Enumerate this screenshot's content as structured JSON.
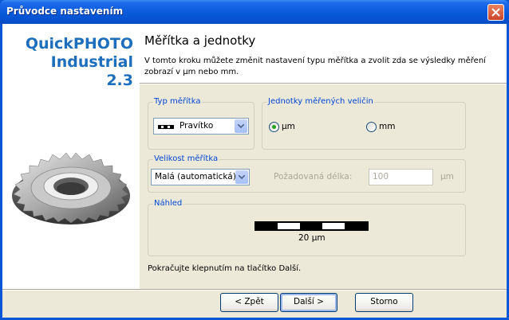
{
  "window": {
    "title": "Průvodce nastavením"
  },
  "brand": {
    "line1": "QuickPHOTO",
    "line2": "Industrial",
    "line3": "2.3"
  },
  "page": {
    "title": "Měřítka a jednotky",
    "description": "V tomto kroku můžete změnit nastavení typu měřítka a zvolit zda se výsledky měření zobrazí v µm nebo mm."
  },
  "scale_type": {
    "label": "Typ měřítka",
    "selected": "Pravítko"
  },
  "units": {
    "label": "Jednotky měřených veličin",
    "option_um": "µm",
    "option_mm": "mm",
    "selected": "µm"
  },
  "scale_size": {
    "label": "Velikost měřítka",
    "selected": "Malá (automatická)",
    "length_label": "Požadovaná délka:",
    "length_value": "100",
    "length_unit": "µm"
  },
  "preview": {
    "label": "Náhled",
    "scale_text": "20 µm"
  },
  "hint": "Pokračujte klepnutím na tlačítko Další.",
  "buttons": {
    "back": "< Zpět",
    "next": "Další >",
    "cancel": "Storno"
  },
  "colors": {
    "title_bar": "#0A5BDC",
    "brand": "#1D6EBD",
    "group_label": "#0046D5",
    "face": "#ECE9D8"
  }
}
